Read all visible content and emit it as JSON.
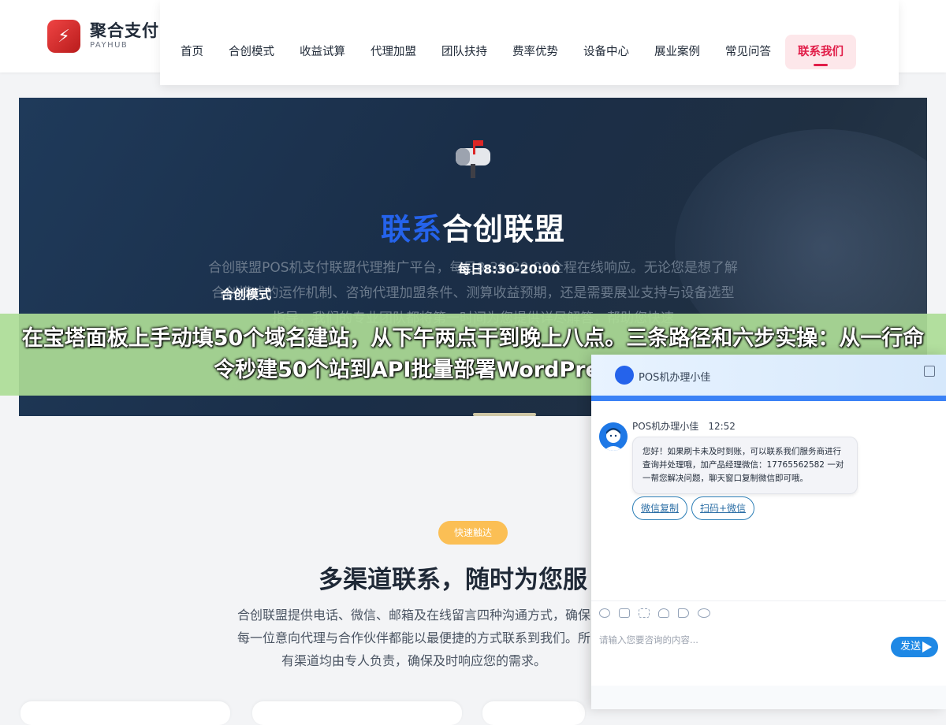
{
  "brand": {
    "name": "聚合支付",
    "sub": "PAYHUB"
  },
  "nav": {
    "items": [
      "首页",
      "合创模式",
      "收益试算",
      "代理加盟",
      "团队扶持",
      "费率优势",
      "设备中心",
      "展业案例",
      "常见问答"
    ],
    "active": "联系我们"
  },
  "hero": {
    "title_blue": "联系",
    "title_white": "合创联盟",
    "desc": "合创联盟POS机支付联盟代理推广平台，每日8:30-20:00全程在线响应。无论您是想了解合创模式的运作机制、咨询代理加盟条件、测算收益预期，还是需要展业支持与设备选型指导，我们的专业团队都将第一时间为您提供详尽解答，帮助您快速",
    "hours": "每日8:30-20:00",
    "label": "合创模式"
  },
  "banner": {
    "text": "在宝塔面板上手动填50个域名建站，从下午两点干到晚上八点。三条路径和六步实操：从一行命令秒建50个站到API批量部署WordPress和SSL证书"
  },
  "section": {
    "pill": "快速触达",
    "title": "多渠道联系，随时为您服",
    "desc": "合创联盟提供电话、微信、邮箱及在线留言四种沟通方式，确保每一位意向代理与合作伙伴都能以最便捷的方式联系到我们。所有渠道均由专人负责，确保及时响应您的需求。"
  },
  "chat": {
    "head_title": "POS机办理小佳",
    "agent_name": "POS机办理小佳",
    "time": "12:52",
    "message": "您好！如果刷卡未及时到账，可以联系我们服务商进行查询并处理哦，加产品经理微信：17765562582 一对一帮您解决问题，聊天窗口复制微信即可哦。",
    "quick_buttons": [
      "微信复制",
      "扫码+微信"
    ],
    "input_placeholder": "请输入您要咨询的内容...",
    "send_label": "发送"
  }
}
